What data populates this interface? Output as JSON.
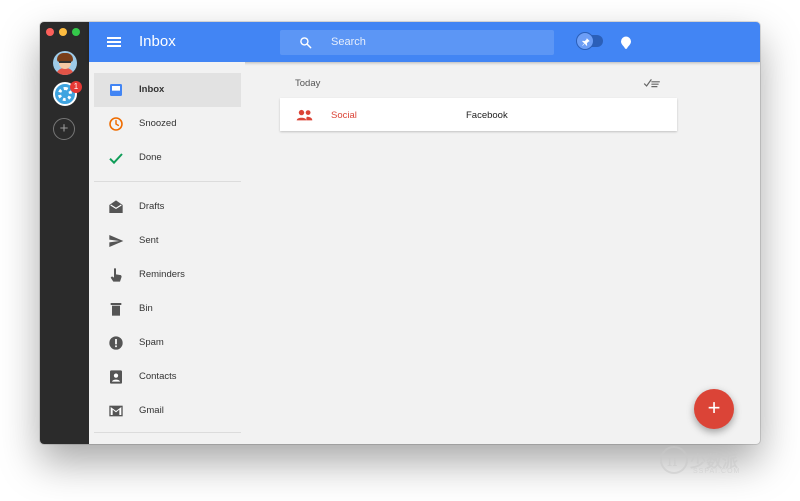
{
  "topbar": {
    "title": "Inbox",
    "search_placeholder": "Search",
    "color": "#4285f4"
  },
  "accounts": {
    "badge_count": "1",
    "add_symbol": "+"
  },
  "sidebar": {
    "items": [
      {
        "label": "Inbox",
        "icon": "inbox-icon",
        "color": "#4285f4",
        "active": true
      },
      {
        "label": "Snoozed",
        "icon": "clock-icon",
        "color": "#ef6c00"
      },
      {
        "label": "Done",
        "icon": "check-icon",
        "color": "#0f9d58"
      },
      {
        "label": "Drafts",
        "icon": "drafts-icon",
        "color": "#555555"
      },
      {
        "label": "Sent",
        "icon": "send-icon",
        "color": "#555555"
      },
      {
        "label": "Reminders",
        "icon": "reminder-hand-icon",
        "color": "#555555"
      },
      {
        "label": "Bin",
        "icon": "trash-icon",
        "color": "#555555"
      },
      {
        "label": "Spam",
        "icon": "spam-icon",
        "color": "#555555"
      },
      {
        "label": "Contacts",
        "icon": "contacts-icon",
        "color": "#555555"
      },
      {
        "label": "Gmail",
        "icon": "gmail-icon",
        "color": "#555555"
      }
    ]
  },
  "main": {
    "section_label": "Today",
    "bundles": [
      {
        "category": "Social",
        "sender": "Facebook",
        "category_color": "#db4437"
      }
    ]
  },
  "fab": {
    "symbol": "+",
    "color": "#db4437"
  },
  "watermark": {
    "brand": "少数派",
    "sub": "SSPAI.COM"
  }
}
